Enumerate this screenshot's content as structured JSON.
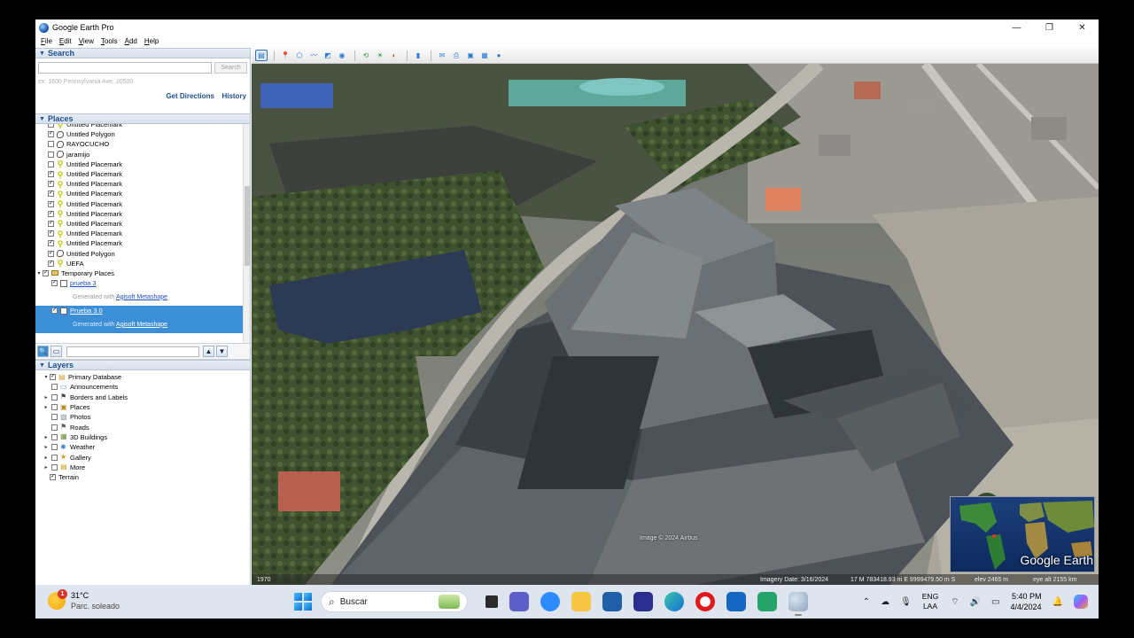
{
  "window": {
    "title": "Google Earth Pro",
    "controls": [
      "—",
      "❐",
      "✕"
    ]
  },
  "menu": [
    "File",
    "Edit",
    "View",
    "Tools",
    "Add",
    "Help"
  ],
  "search": {
    "header": "Search",
    "input_value": "",
    "button_label": "Search",
    "example": "ex: 1600 Pennsylvania Ave, 20500",
    "get_directions": "Get Directions",
    "history": "History"
  },
  "places": {
    "header": "Places",
    "items": [
      {
        "label": "Untitled Placemark",
        "icon": "placemark-icon",
        "checked": true,
        "partial": true
      },
      {
        "label": "Untitled Polygon",
        "icon": "polygon-icon",
        "checked": true
      },
      {
        "label": "RAYOCUCHO",
        "icon": "polygon-icon",
        "checked": false
      },
      {
        "label": "jaramijo",
        "icon": "polygon-icon",
        "checked": false
      },
      {
        "label": "Untitled Placemark",
        "icon": "placemark-icon",
        "checked": false
      },
      {
        "label": "Untitled Placemark",
        "icon": "placemark-icon",
        "checked": true
      },
      {
        "label": "Untitled Placemark",
        "icon": "placemark-icon",
        "checked": true
      },
      {
        "label": "Untitled Placemark",
        "icon": "placemark-icon",
        "checked": true
      },
      {
        "label": "Untitled Placemark",
        "icon": "placemark-icon",
        "checked": true
      },
      {
        "label": "Untitled Placemark",
        "icon": "placemark-icon",
        "checked": true
      },
      {
        "label": "Untitled Placemark",
        "icon": "placemark-icon",
        "checked": true
      },
      {
        "label": "Untitled Placemark",
        "icon": "placemark-icon",
        "checked": true
      },
      {
        "label": "Untitled Placemark",
        "icon": "placemark-icon",
        "checked": true
      },
      {
        "label": "Untitled Polygon",
        "icon": "polygon-icon",
        "checked": true
      },
      {
        "label": "UEFA",
        "icon": "placemark-icon",
        "checked": true
      }
    ],
    "temporary": {
      "label": "Temporary Places",
      "entries": [
        {
          "name": "prueba 3",
          "generated_with": "Generated with",
          "generator": "Agisoft Metashape",
          "selected": false
        },
        {
          "name": "Prueba 3.0",
          "generated_with": "Generated with",
          "generator": "Agisoft Metashape",
          "selected": true
        }
      ]
    }
  },
  "layers": {
    "header": "Layers",
    "items": [
      {
        "label": "Primary Database",
        "icon": "folder-icon",
        "expand": "▾",
        "level": 0,
        "checked": true
      },
      {
        "label": "Announcements",
        "icon": "announcement-icon",
        "expand": "",
        "level": 1,
        "checked": false
      },
      {
        "label": "Borders and Labels",
        "icon": "flag-icon",
        "expand": "▸",
        "level": 1,
        "checked": false
      },
      {
        "label": "Places",
        "icon": "places-icon",
        "expand": "▸",
        "level": 1,
        "checked": false
      },
      {
        "label": "Photos",
        "icon": "photo-icon",
        "expand": "",
        "level": 1,
        "checked": false
      },
      {
        "label": "Roads",
        "icon": "road-icon",
        "expand": "",
        "level": 1,
        "checked": false
      },
      {
        "label": "3D Buildings",
        "icon": "buildings-icon",
        "expand": "▸",
        "level": 1,
        "checked": false
      },
      {
        "label": "Weather",
        "icon": "weather-icon",
        "expand": "▸",
        "level": 1,
        "checked": false
      },
      {
        "label": "Gallery",
        "icon": "gallery-icon",
        "expand": "▸",
        "level": 1,
        "checked": false
      },
      {
        "label": "More",
        "icon": "more-icon",
        "expand": "▸",
        "level": 1,
        "checked": false
      },
      {
        "label": "Terrain",
        "icon": "",
        "expand": "",
        "level": 0,
        "checked": true
      }
    ]
  },
  "map": {
    "credit": "Image © 2024 Airbus",
    "year": "1970",
    "imagery_date": "Imagery Date: 3/16/2024",
    "coords": "17 M 783418.93 m E 9999479.50 m S",
    "elev": "elev 2465 m",
    "eye_alt": "eye alt 2155 km",
    "logo": "Google Earth"
  },
  "taskbar": {
    "weather_temp": "31°C",
    "weather_desc": "Parc. soleado",
    "weather_badge": "1",
    "search_placeholder": "Buscar",
    "lang_top": "ENG",
    "lang_bottom": "LAA",
    "time": "5:40 PM",
    "date": "4/4/2024"
  }
}
